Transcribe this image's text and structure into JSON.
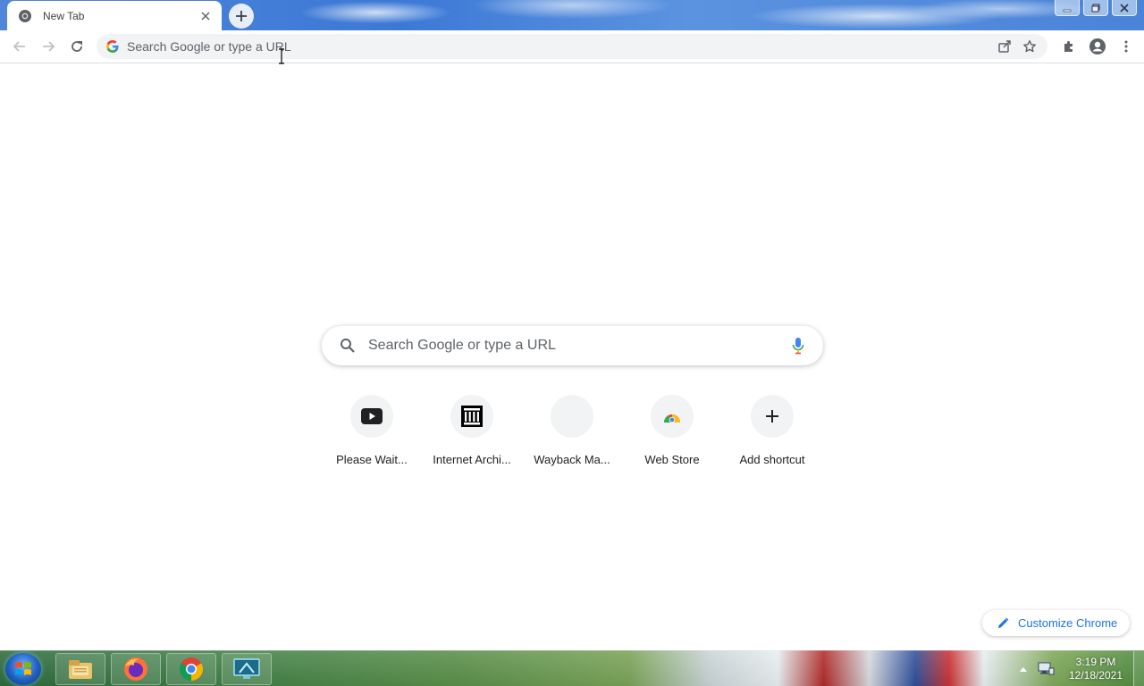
{
  "tab": {
    "title": "New Tab"
  },
  "omnibox": {
    "placeholder": "Search Google or type a URL"
  },
  "search": {
    "placeholder": "Search Google or type a URL"
  },
  "shortcuts": [
    {
      "label": "Please Wait...",
      "icon": "youtube-icon"
    },
    {
      "label": "Internet Archi...",
      "icon": "internet-archive-icon"
    },
    {
      "label": "Wayback Ma...",
      "icon": "blank-favicon"
    },
    {
      "label": "Web Store",
      "icon": "chrome-web-store-icon"
    },
    {
      "label": "Add shortcut",
      "icon": "plus-icon"
    }
  ],
  "customize": {
    "label": "Customize Chrome"
  },
  "taskbar": {
    "apps": [
      "file-explorer-icon",
      "firefox-icon",
      "chrome-icon",
      "remote-desktop-icon"
    ],
    "time": "3:19 PM",
    "date": "12/18/2021"
  },
  "colors": {
    "accent": "#1a73e8",
    "tab_bg": "#ffffff",
    "omnibox_bg": "#f1f3f4"
  }
}
